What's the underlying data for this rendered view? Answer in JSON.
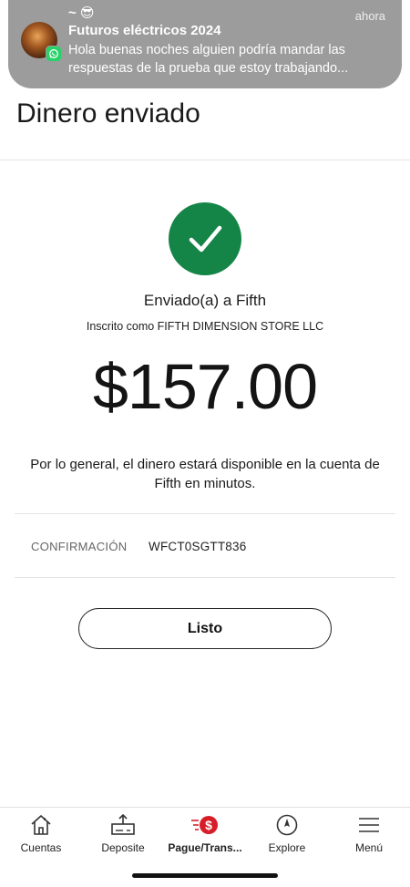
{
  "notification": {
    "sender": "~ 😎",
    "title": "Futuros eléctricos 2024",
    "time": "ahora",
    "message": "Hola buenas noches alguien podría mandar las respuestas de la prueba que estoy trabajando...",
    "app_icon": "whatsapp-icon"
  },
  "header": {
    "title": "Dinero enviado"
  },
  "confirmation_screen": {
    "status_icon": "checkmark-icon",
    "status_color": "#148547",
    "sent_to": "Enviado(a) a Fifth",
    "enrolled_as": "Inscrito como FIFTH DIMENSION STORE LLC",
    "amount": "$157.00",
    "availability_note": "Por lo general, el dinero estará disponible en la cuenta de Fifth en minutos.",
    "confirmation_label": "CONFIRMACIÓN",
    "confirmation_number": "WFCT0SGTT836",
    "done_button": "Listo"
  },
  "bottom_nav": {
    "items": [
      {
        "label": "Cuentas",
        "icon": "home-icon"
      },
      {
        "label": "Deposite",
        "icon": "deposit-icon"
      },
      {
        "label": "Pague/Trans...",
        "icon": "pay-transfer-icon",
        "active": true
      },
      {
        "label": "Explore",
        "icon": "compass-icon"
      },
      {
        "label": "Menú",
        "icon": "menu-icon"
      }
    ],
    "accent_color": "#d71e28"
  }
}
